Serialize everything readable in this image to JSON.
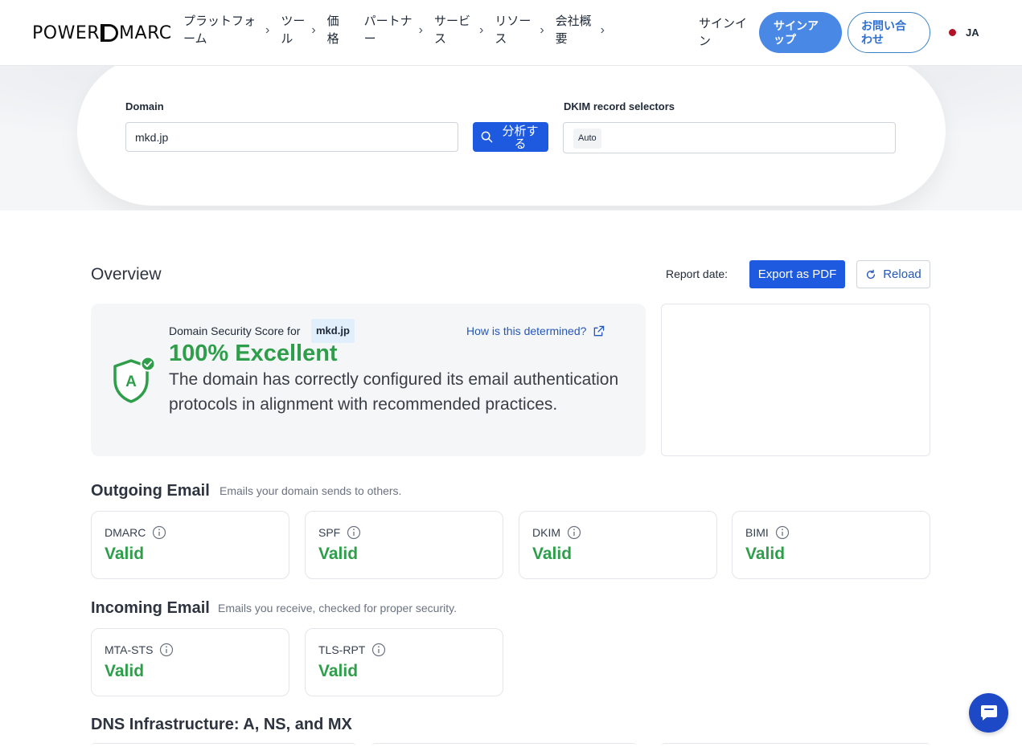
{
  "header": {
    "logo_text_left": "POWER",
    "logo_text_right": "MARC",
    "nav": [
      {
        "label": "プラットフォーム"
      },
      {
        "label": "ツール"
      },
      {
        "label": "価格"
      },
      {
        "label": "パートナー"
      },
      {
        "label": "サービス"
      },
      {
        "label": "リソース"
      },
      {
        "label": "会社概要"
      }
    ],
    "signin_label": "サインイン",
    "signup_label": "サインアップ",
    "contact_label": "お問い合わせ",
    "language": "JA"
  },
  "search": {
    "domain_label": "Domain",
    "domain_value": "mkd.jp",
    "analyze_label": "分析する",
    "dkim_label": "DKIM record selectors",
    "dkim_value": "Auto"
  },
  "overview": {
    "title": "Overview",
    "report_date_label": "Report date:",
    "export_label": "Export as PDF",
    "reload_label": "Reload"
  },
  "score": {
    "for_label": "Domain Security Score for",
    "domain": "mkd.jp",
    "how_link": "How is this determined?",
    "value": "100% Excellent",
    "description": "The domain has correctly configured its email authentication protocols in alignment with recommended practices.",
    "shield_letter": "A"
  },
  "outgoing": {
    "title": "Outgoing Email",
    "subtitle": "Emails your domain sends to others.",
    "cards": [
      {
        "name": "DMARC",
        "status": "Valid"
      },
      {
        "name": "SPF",
        "status": "Valid"
      },
      {
        "name": "DKIM",
        "status": "Valid"
      },
      {
        "name": "BIMI",
        "status": "Valid"
      }
    ]
  },
  "incoming": {
    "title": "Incoming Email",
    "subtitle": "Emails you receive, checked for proper security.",
    "cards": [
      {
        "name": "MTA-STS",
        "status": "Valid"
      },
      {
        "name": "TLS-RPT",
        "status": "Valid"
      }
    ]
  },
  "dns": {
    "title": "DNS Infrastructure: A, NS, and MX"
  },
  "colors": {
    "brand_blue": "#1d5ae0",
    "valid_green": "#2e9e4a",
    "link_blue": "#2557b8"
  },
  "icons": [
    "chevron-right-icon",
    "search-icon",
    "reload-icon",
    "shield-check-icon",
    "external-link-icon",
    "info-icon",
    "chat-icon"
  ]
}
